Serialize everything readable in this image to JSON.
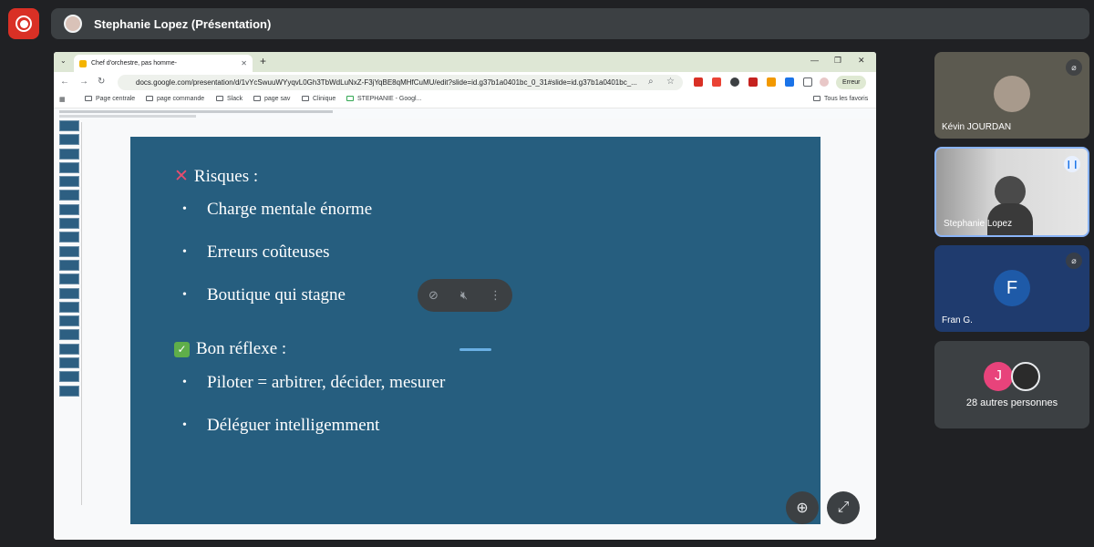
{
  "presentation_banner": {
    "title": "Stephanie Lopez (Présentation)"
  },
  "browser": {
    "tab_title": "Chef d'orchestre, pas homme-",
    "url": "docs.google.com/presentation/d/1vYcSwuuWYyqvL0Gh3TbWdLuNxZ-F3jYqBE8qMHfCuMU/edit?slide=id.g37b1a0401bc_0_31#slide=id.g37b1a0401bc_...",
    "error_chip": "Erreur",
    "bookmarks": [
      "Page centrale",
      "page commande",
      "Slack",
      "page sav",
      "Clinique",
      "STEPHANIE - Googl...",
      "Tous les favoris"
    ]
  },
  "slide": {
    "risks_heading": "Risques :",
    "risks": [
      "Charge mentale énorme",
      "Erreurs coûteuses",
      "Boutique qui stagne"
    ],
    "good_heading": "Bon réflexe :",
    "good": [
      "Piloter = arbitrer, décider, mesurer",
      "Déléguer intelligemment"
    ]
  },
  "participants": [
    {
      "name": "Kévin JOURDAN",
      "muted": true
    },
    {
      "name": "Stephanie Lopez",
      "speaking": true
    },
    {
      "name": "Fran G.",
      "initial": "F",
      "muted": true
    },
    {
      "name": "28 autres personnes",
      "initial": "J"
    }
  ],
  "colors": {
    "slide_bg": "#265e7f",
    "record": "#d93025",
    "meet_bg": "#202124"
  }
}
